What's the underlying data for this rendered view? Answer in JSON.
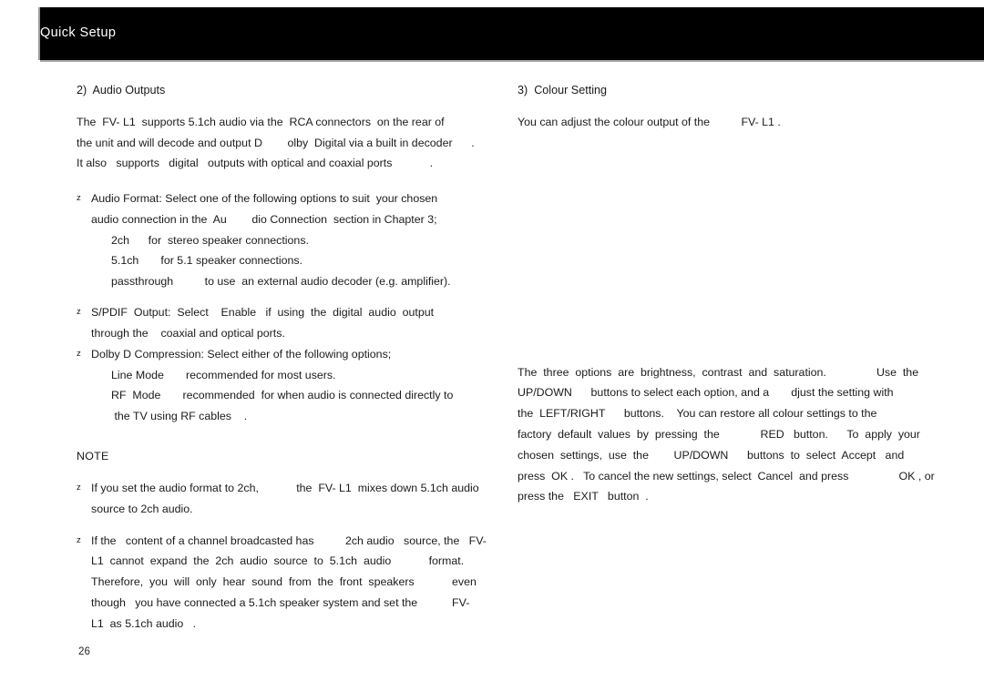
{
  "header": {
    "title": "Quick Setup"
  },
  "left_column": {
    "section_heading": "2)  Audio Outputs",
    "intro_paragraph": [
      "The  FV- L1  supports 5.1ch audio via the  RCA connectors  on the rear of",
      "the unit and will decode and output D        olby  Digital via a built in decoder      .",
      "It also   supports   digital   outputs with optical and coaxial ports            ."
    ],
    "bullets": [
      {
        "marker": "z",
        "lines": [
          "Audio Format: Select one of the following options to suit  your chosen",
          "audio connection in the  Au        dio Connection  section in Chapter 3;"
        ],
        "sub_items": [
          "2ch      for  stereo speaker connections.",
          "5.1ch       for 5.1 speaker connections.",
          "passthrough          to use  an external audio decoder (e.g. amplifier)."
        ]
      },
      {
        "marker": "z",
        "lines": [
          "S/PDIF  Output:  Select    Enable   if  using  the  digital  audio  output",
          "through the    coaxial and optical ports."
        ],
        "sub_items": []
      },
      {
        "marker": "z",
        "lines": [
          "Dolby D Compression: Select either of the following options;"
        ],
        "sub_items": [
          "Line Mode       recommended for most users.",
          "RF  Mode       recommended  for when audio is connected directly to",
          " the TV using RF cables    ."
        ]
      }
    ],
    "note_heading": "NOTE",
    "note_bullets": [
      {
        "marker": "z",
        "lines": [
          "If you set the audio format to 2ch,            the  FV- L1  mixes down 5.1ch audio",
          "source to 2ch audio."
        ]
      },
      {
        "marker": "z",
        "lines": [
          "If the   content of a channel broadcasted has          2ch audio   source, the   FV-",
          "L1  cannot  expand  the  2ch  audio  source  to  5.1ch  audio            format.",
          "Therefore,  you  will  only  hear  sound  from  the  front  speakers            even",
          "though   you have connected a 5.1ch speaker system and set the           FV-",
          "L1  as 5.1ch audio   ."
        ]
      }
    ]
  },
  "right_column": {
    "section_heading": "3)  Colour Setting",
    "intro_paragraph": [
      "You can adjust the colour output of the          FV- L1 ."
    ],
    "body_paragraph": [
      "The  three  options  are  brightness,  contrast  and  saturation.                Use  the",
      "UP/DOWN      buttons to select each option, and a       djust the setting with",
      "the  LEFT/RIGHT      buttons.    You can restore all colour settings to the",
      "factory  default  values  by  pressing  the             RED   button.      To  apply  your",
      "chosen  settings,  use  the        UP/DOWN      buttons  to  select  Accept   and",
      "press  OK .   To cancel the new settings, select  Cancel  and press                OK , or",
      "press the   EXIT   button  ."
    ]
  },
  "footer": {
    "page_number": "26"
  }
}
